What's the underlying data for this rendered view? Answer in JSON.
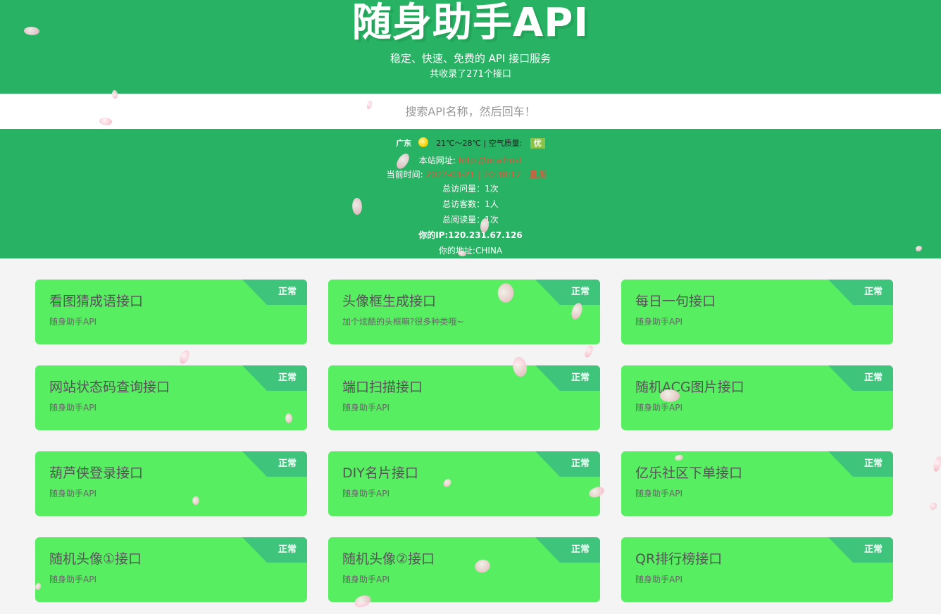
{
  "header": {
    "title": "随身助手API",
    "subtitle": "稳定、快速、免费的 API 接口服务",
    "count": "共收录了271个接口"
  },
  "search": {
    "placeholder": "搜索API名称，然后回车！"
  },
  "info": {
    "weather_city": "广东",
    "weather_icon": "sun-icon",
    "weather_temp": "21℃～28℃ | 空气质量:",
    "weather_aqi": "优",
    "site_label": "本站网址:",
    "site_url": "http://localhost",
    "time_label": "当前时间:",
    "time_value": "2022-03-21 | 20:38:12 | 星期一",
    "visits": "总访问量：1次",
    "visitors": "总访客数：1人",
    "reads": "总阅读量：1次",
    "ip": "你的IP:120.231.67.126",
    "location": "你的地址:CHINA"
  },
  "cards": [
    {
      "name": "看图猜成语接口",
      "desc": "随身助手API",
      "status": "正常"
    },
    {
      "name": "头像框生成接口",
      "desc": "加个炫酷的头框嘛?很多种类哦~",
      "status": "正常"
    },
    {
      "name": "每日一句接口",
      "desc": "随身助手API",
      "status": "正常"
    },
    {
      "name": "网站状态码查询接口",
      "desc": "随身助手API",
      "status": "正常"
    },
    {
      "name": "端口扫描接口",
      "desc": "随身助手API",
      "status": "正常"
    },
    {
      "name": "随机ACG图片接口",
      "desc": "随身助手API",
      "status": "正常"
    },
    {
      "name": "葫芦侠登录接口",
      "desc": "随身助手API",
      "status": "正常"
    },
    {
      "name": "DIY名片接口",
      "desc": "随身助手API",
      "status": "正常"
    },
    {
      "name": "亿乐社区下单接口",
      "desc": "随身助手API",
      "status": "正常"
    },
    {
      "name": "随机头像①接口",
      "desc": "随身助手API",
      "status": "正常"
    },
    {
      "name": "随机头像②接口",
      "desc": "随身助手API",
      "status": "正常"
    },
    {
      "name": "QR排行榜接口",
      "desc": "随身助手API",
      "status": "正常"
    }
  ],
  "colors": {
    "header_bg": "#28b263",
    "card_bg": "#57ee62",
    "badge_bg": "#3fc47b",
    "accent_red": "#e8523a"
  }
}
